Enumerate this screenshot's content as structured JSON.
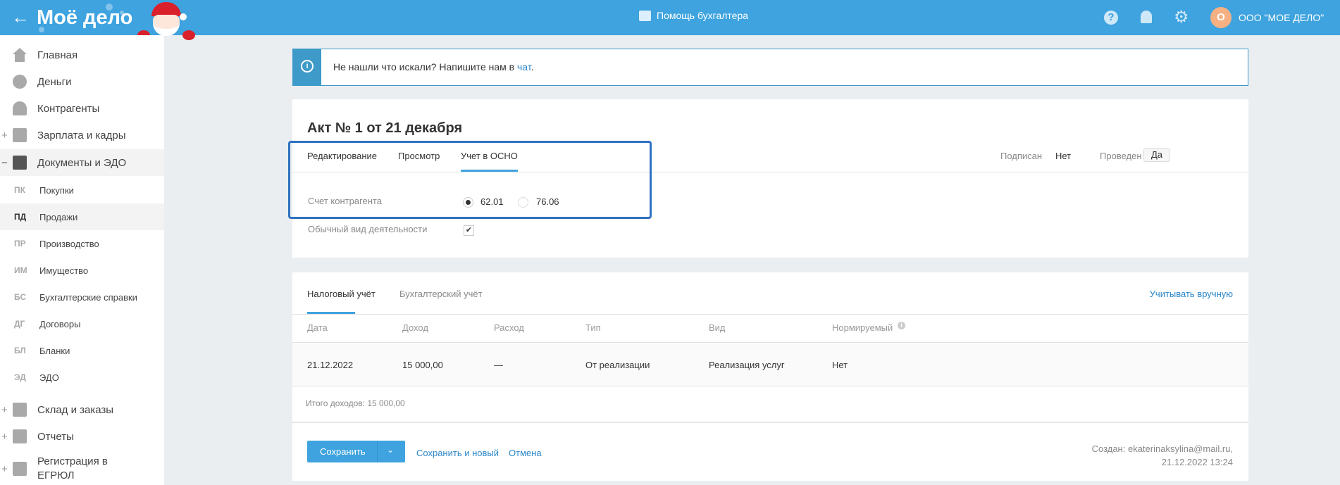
{
  "header": {
    "logo": "Моё дело",
    "help_center": "Помощь бухгалтера",
    "avatar_letter": "О",
    "company": "ООО \"МОЕ ДЕЛО\""
  },
  "sidebar": {
    "items": [
      {
        "label": "Главная",
        "icon": "home-icon"
      },
      {
        "label": "Деньги",
        "icon": "money-icon"
      },
      {
        "label": "Контрагенты",
        "icon": "contractor-icon"
      },
      {
        "label": "Зарплата и кадры",
        "icon": "wallet-icon",
        "expander": "+"
      },
      {
        "label": "Документы и ЭДО",
        "icon": "folder-icon",
        "expander": "−"
      }
    ],
    "sub_items": [
      {
        "abbr": "ПК",
        "label": "Покупки"
      },
      {
        "abbr": "ПД",
        "label": "Продажи"
      },
      {
        "abbr": "ПР",
        "label": "Производство"
      },
      {
        "abbr": "ИМ",
        "label": "Имущество"
      },
      {
        "abbr": "БС",
        "label": "Бухгалтерские справки"
      },
      {
        "abbr": "ДГ",
        "label": "Договоры"
      },
      {
        "abbr": "БЛ",
        "label": "Бланки"
      },
      {
        "abbr": "ЭД",
        "label": "ЭДО"
      }
    ],
    "bottom_items": [
      {
        "label": "Склад и заказы",
        "expander": "+"
      },
      {
        "label": "Отчеты",
        "expander": "+"
      },
      {
        "label": "Регистрация в ЕГРЮЛ",
        "expander": "+"
      }
    ]
  },
  "info": {
    "text": "Не нашли что искали? Напишите нам в ",
    "link": "чат",
    "end": "."
  },
  "doc": {
    "title": "Акт № 1 от 21 декабря",
    "tabs": [
      "Редактирование",
      "Просмотр",
      "Учет в ОСНО"
    ],
    "signed_label": "Подписан",
    "signed_value": "Нет",
    "posted_label": "Проведен",
    "posted_value": "Да",
    "account_label": "Счет контрагента",
    "account_options": [
      "62.01",
      "76.06"
    ],
    "activity_label": "Обычный вид деятельности"
  },
  "accounting": {
    "tabs": [
      "Налоговый учёт",
      "Бухгалтерский учёт"
    ],
    "manual_link": "Учитывать вручную",
    "columns": [
      "Дата",
      "Доход",
      "Расход",
      "Тип",
      "Вид",
      "Нормируемый"
    ],
    "rows": [
      [
        "21.12.2022",
        "15 000,00",
        "—",
        "От реализации",
        "Реализация услуг",
        "Нет"
      ]
    ],
    "total": "Итого доходов: 15 000,00"
  },
  "footer": {
    "save": "Сохранить",
    "save_new": "Сохранить и новый",
    "cancel": "Отмена",
    "created_line1": "Создан: ekaterinaksylina@mail.ru,",
    "created_line2": "21.12.2022 13:24"
  },
  "colors": {
    "brand": "#3ea3df",
    "link": "#2b87c9",
    "highlight": "#2f72c0",
    "avatar": "#f7b081"
  }
}
